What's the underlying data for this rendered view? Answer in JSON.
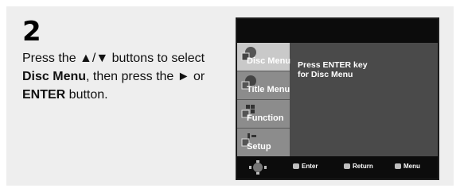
{
  "step": {
    "number": "2"
  },
  "instructions": {
    "line_parts": [
      {
        "text": "Press the ▲/▼ buttons to select ",
        "bold": false
      },
      {
        "text": "Disc Menu",
        "bold": true
      },
      {
        "text": ", then press the ► or ",
        "bold": false
      },
      {
        "text": "ENTER",
        "bold": true
      },
      {
        "text": " button.",
        "bold": false
      }
    ]
  },
  "screen": {
    "sidebar": [
      {
        "label": "Disc Menu",
        "icon": "disc-menu-icon",
        "active": true
      },
      {
        "label": "Title Menu",
        "icon": "title-menu-icon",
        "active": false
      },
      {
        "label": "Function",
        "icon": "function-icon",
        "active": false
      },
      {
        "label": "Setup",
        "icon": "setup-icon",
        "active": false
      }
    ],
    "message": [
      "Press ENTER key",
      "for Disc Menu"
    ],
    "bottom_bar": {
      "enter_label": "Enter",
      "return_label": "Return",
      "menu_label": "Menu"
    }
  }
}
